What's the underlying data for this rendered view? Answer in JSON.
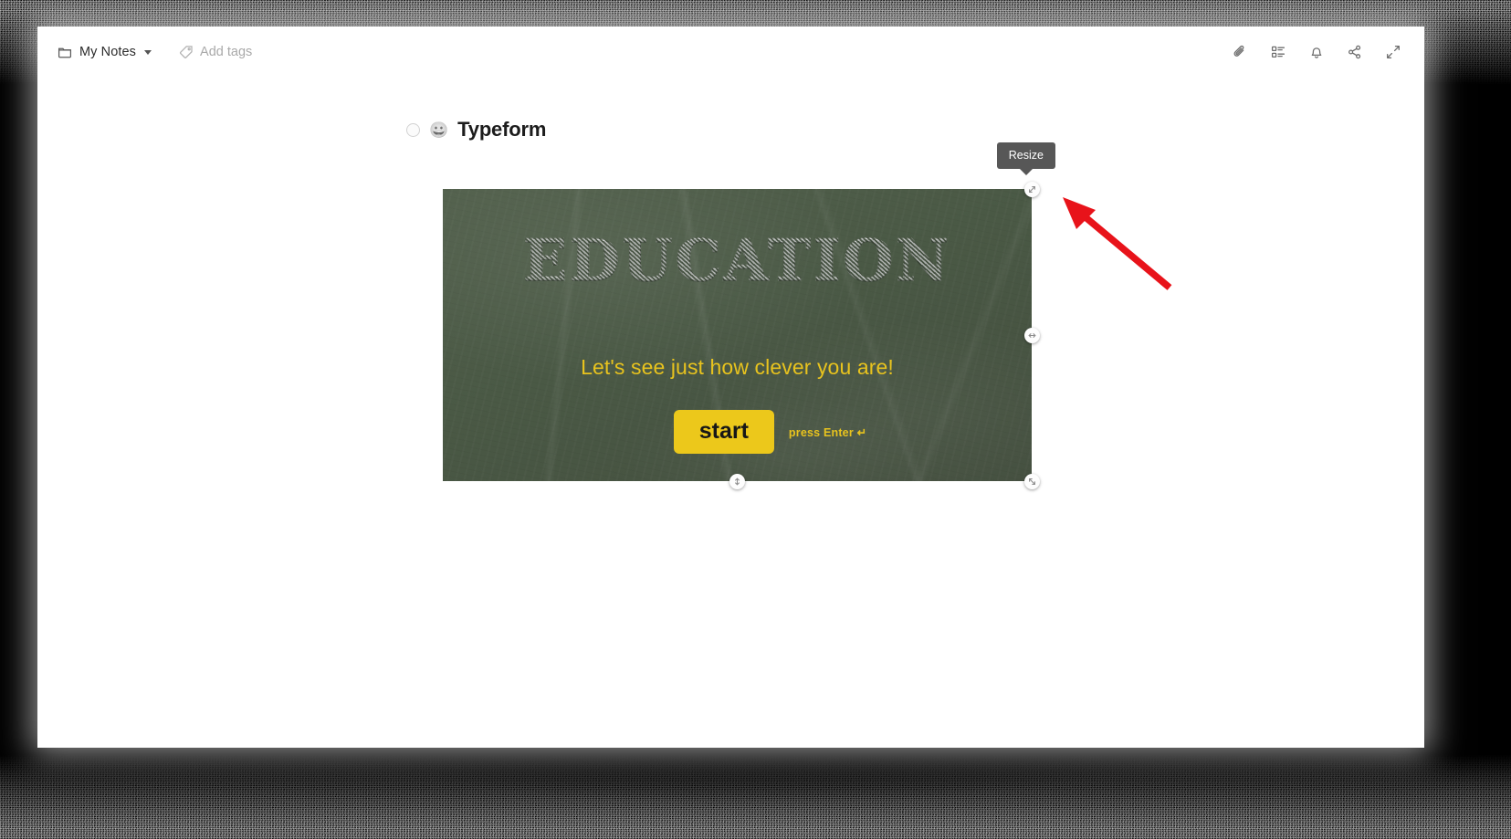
{
  "window": {
    "frame_style": "noise-border"
  },
  "toolbar": {
    "folder_name": "My Notes",
    "folder_icon": "folder-icon",
    "dropdown_icon": "chevron-down-icon",
    "tags_label": "Add tags",
    "tags_icon": "tag-icon",
    "actions": [
      {
        "name": "attachment-icon",
        "label": "Attachments"
      },
      {
        "name": "note-info-icon",
        "label": "Note info"
      },
      {
        "name": "bell-icon",
        "label": "Reminder"
      },
      {
        "name": "share-icon",
        "label": "Share"
      },
      {
        "name": "expand-icon",
        "label": "Expand"
      }
    ]
  },
  "note": {
    "checkbox_state": "unchecked",
    "emoji": "😀",
    "title": "Typeform"
  },
  "embed": {
    "type": "typeform-chalkboard",
    "heading": "EDUCATION",
    "subtitle": "Let's see just how clever you are!",
    "start_button": "start",
    "press_enter": "press Enter ↵",
    "colors": {
      "board": "#4c5b47",
      "chalk": "#e6e8e2",
      "accent_yellow": "#ecc81b",
      "button_text": "#171717"
    }
  },
  "tooltip": {
    "text": "Resize"
  },
  "handles": [
    {
      "name": "resize-handle-top-right",
      "position": "top-right"
    },
    {
      "name": "resize-handle-right",
      "position": "right-middle"
    },
    {
      "name": "resize-handle-bottom-right",
      "position": "bottom-right"
    },
    {
      "name": "resize-handle-bottom",
      "position": "bottom-center"
    }
  ],
  "annotation": {
    "type": "arrow",
    "color": "#e8131a",
    "points_to": "resize-handle-top-right"
  }
}
